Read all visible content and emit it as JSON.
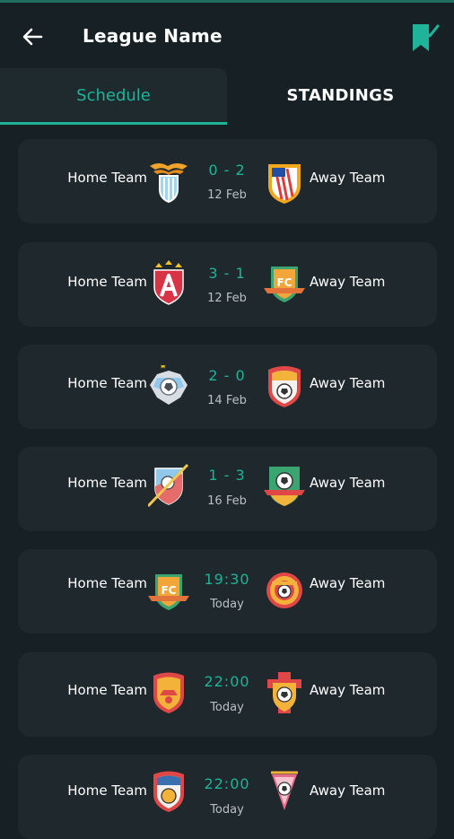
{
  "header": {
    "title": "League Name",
    "back_icon": "arrow-left-icon",
    "bookmark_icon": "bookmark-check-icon"
  },
  "tabs": [
    {
      "label": "Schedule",
      "active": true
    },
    {
      "label": "STANDINGS",
      "active": false
    }
  ],
  "colors": {
    "accent": "#1fb39a",
    "background": "#172024",
    "card": "#1f282d"
  },
  "matches": [
    {
      "home": "Home Team",
      "away": "Away Team",
      "score": "0 - 2",
      "date": "12 Feb",
      "home_logo": "winged-shield-crest",
      "away_logo": "striped-shield-crest"
    },
    {
      "home": "Home Team",
      "away": "Away Team",
      "score": "3 - 1",
      "date": "12 Feb",
      "home_logo": "red-a-shield-crest",
      "away_logo": "fc-badge-crest"
    },
    {
      "home": "Home Team",
      "away": "Away Team",
      "score": "2 - 0",
      "date": "14 Feb",
      "home_logo": "silver-ball-crest",
      "away_logo": "red-shield-ball-crest"
    },
    {
      "home": "Home Team",
      "away": "Away Team",
      "score": "1 - 3",
      "date": "16 Feb",
      "home_logo": "sash-shield-crest",
      "away_logo": "green-shield-ball-crest"
    },
    {
      "home": "Home Team",
      "away": "Away Team",
      "score": "19:30",
      "date": "Today",
      "home_logo": "fc-badge-crest",
      "away_logo": "gear-ball-crest"
    },
    {
      "home": "Home Team",
      "away": "Away Team",
      "score": "22:00",
      "date": "Today",
      "home_logo": "orange-shield-crest",
      "away_logo": "cross-ball-crest"
    },
    {
      "home": "Home Team",
      "away": "Away Team",
      "score": "22:00",
      "date": "Today",
      "home_logo": "striped-ball-crest",
      "away_logo": "pennant-ball-crest"
    }
  ]
}
